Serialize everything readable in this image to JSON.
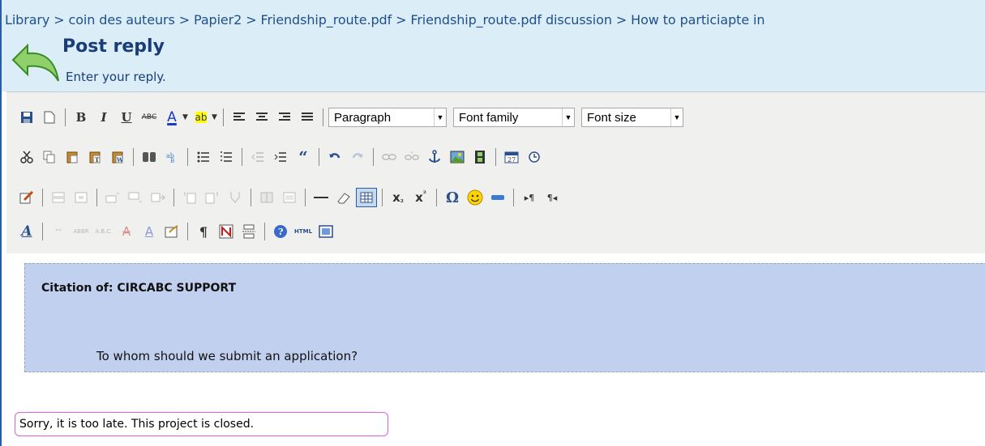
{
  "breadcrumb": "Library > coin des auteurs > Papier2 > Friendship_route.pdf > Friendship_route.pdf discussion > How to particiapte in",
  "header": {
    "title": "Post reply",
    "subtitle": "Enter your reply."
  },
  "toolbar": {
    "row1": {
      "bold": "B",
      "italic": "I",
      "underline": "U",
      "strike": "ABC",
      "forecolor": "A",
      "backcolor": "ab",
      "format_select": "Paragraph",
      "fontfamily_select": "Font family",
      "fontsize_select": "Font size"
    },
    "row2": {
      "blockquote": "“",
      "subscript_base": "x",
      "subscript": "2",
      "omega": "Ω"
    },
    "row3": {
      "subscript": "x",
      "sub_mark": "₂",
      "superscript": "x",
      "sup_mark": "²",
      "charmap": "Ω",
      "ltr": "▸¶",
      "rtl": "¶◂"
    },
    "row4": {
      "styleprops": "A",
      "cite": "“”",
      "abbr": "ABBR",
      "acronym": "A.B.C.",
      "del": "A",
      "ins": "A",
      "pilcrow": "¶",
      "html": "HTML"
    }
  },
  "content": {
    "citation_title": "Citation of: CIRCABC SUPPORT",
    "citation_text": "To whom should we submit an application?",
    "reply_text": "Sorry, it is too late. This project is closed."
  },
  "colors": {
    "header_bg": "#dbeef7",
    "header_text": "#1a3c78",
    "citation_bg": "#c0d0ee",
    "highlight_border": "#e060e0"
  }
}
